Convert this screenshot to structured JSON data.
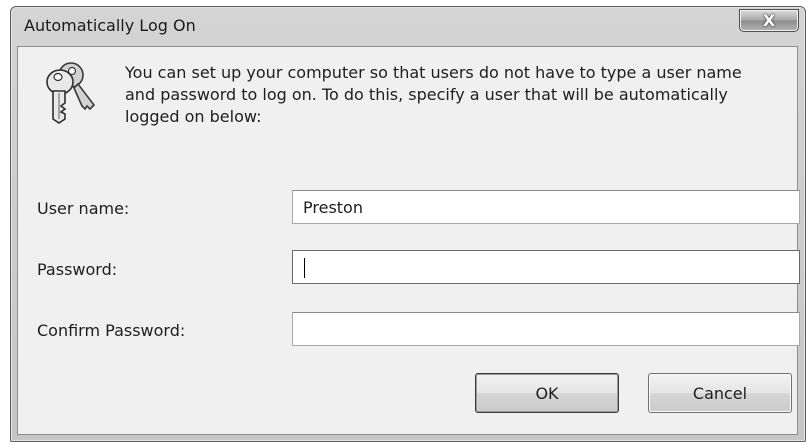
{
  "window": {
    "title": "Automatically Log On",
    "close_glyph": "X"
  },
  "icon": {
    "name": "keys-icon"
  },
  "description": "You can set up your computer so that users do not have to type a user name and password to log on. To do this, specify a user that will be automatically logged on below:",
  "form": {
    "username_label": "User name:",
    "username_value": "Preston",
    "password_label": "Password:",
    "password_value": "",
    "confirm_label": "Confirm Password:",
    "confirm_value": ""
  },
  "buttons": {
    "ok_label": "OK",
    "cancel_label": "Cancel"
  },
  "colors": {
    "dialog_background": "#f0f0f0",
    "frame": "#c6c6c6"
  }
}
